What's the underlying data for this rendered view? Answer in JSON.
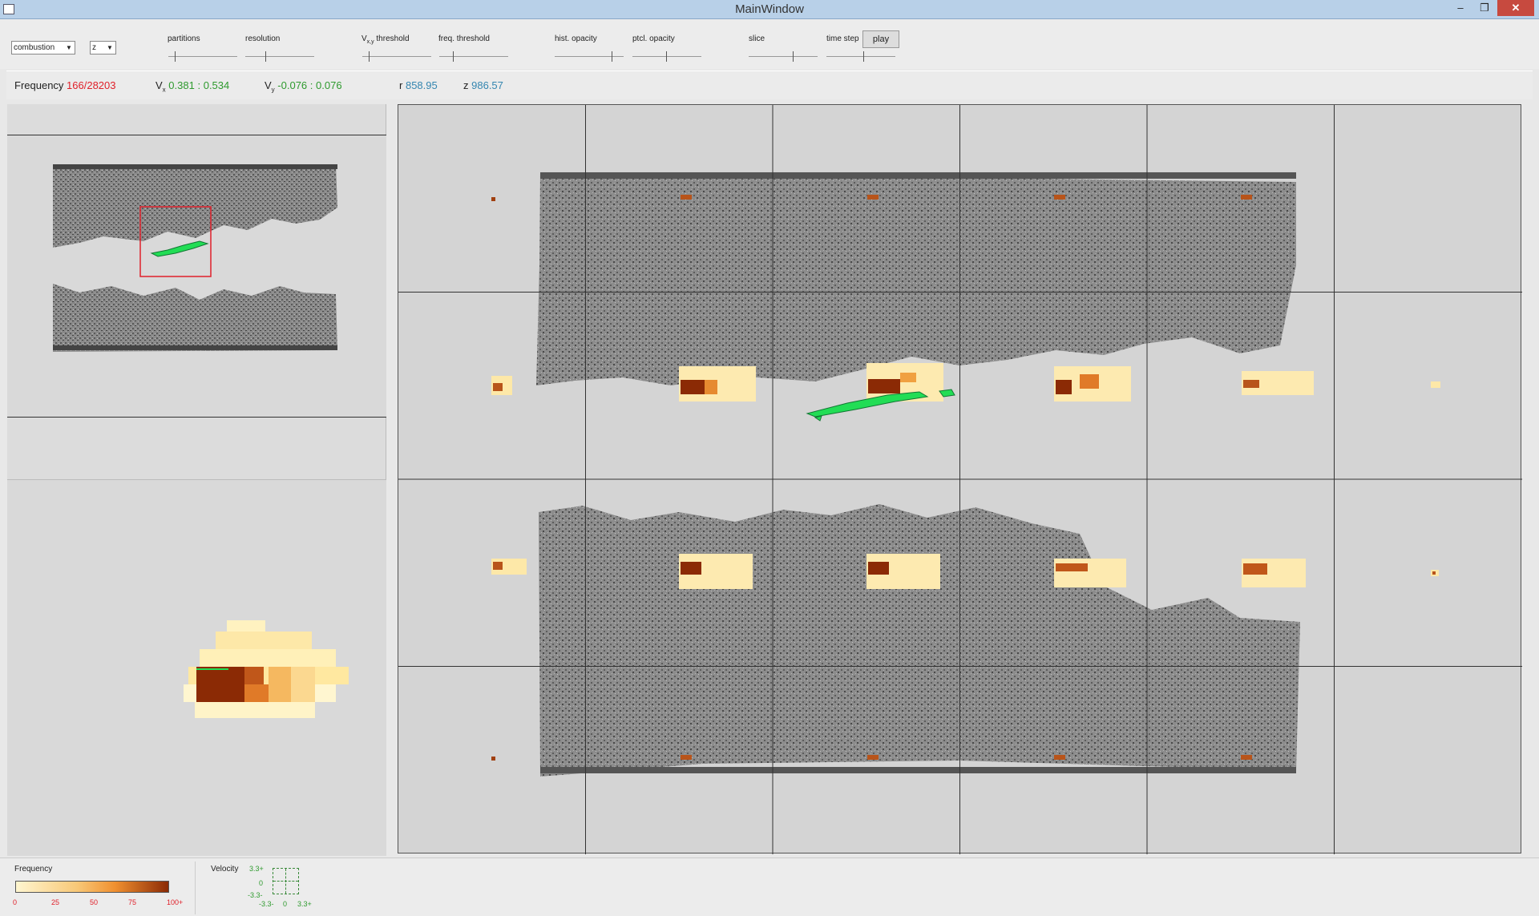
{
  "window": {
    "title": "MainWindow",
    "minimize": "–",
    "maximize": "❐",
    "close": "✕"
  },
  "toolbar": {
    "dataset_select": "combustion",
    "axis_select": "z",
    "labels": {
      "partitions": "partitions",
      "resolution": "resolution",
      "vxy_threshold_prefix": "V",
      "vxy_threshold_sub": "x,y",
      "vxy_threshold_suffix": " threshold",
      "freq_threshold": "freq. threshold",
      "hist_opacity": "hist. opacity",
      "ptcl_opacity": "ptcl. opacity",
      "slice": "slice",
      "time_step": "time step"
    },
    "play_label": "play",
    "slider_levels": {
      "partitions": 0.1,
      "resolution": 0.3,
      "vxy_threshold": 0.1,
      "freq_threshold": 0.2,
      "hist_opacity": 0.85,
      "ptcl_opacity": 0.5,
      "slice": 0.65,
      "time_step": 0.55
    }
  },
  "info": {
    "frequency_label": "Frequency",
    "frequency_value": "166/28203",
    "vx_label": "V",
    "vx_sub": "x",
    "vx_min": "0.381",
    "vx_sep": ":",
    "vx_max": "0.534",
    "vy_label": "V",
    "vy_sub": "y",
    "vy_min": "-0.076",
    "vy_sep": ":",
    "vy_max": "0.076",
    "r_label": "r",
    "r_value": "858.95",
    "z_label": "z",
    "z_value": "986.57"
  },
  "legend": {
    "frequency_title": "Frequency",
    "frequency_ticks": [
      "0",
      "25",
      "50",
      "75",
      "100+"
    ],
    "velocity_title": "Velocity",
    "velocity_y_ticks": [
      "3.3+",
      "0",
      "-3.3-"
    ],
    "velocity_x_ticks": [
      "-3.3-",
      "0",
      "3.3+"
    ]
  },
  "colors": {
    "freq_low": "#fff6d0",
    "freq_mid": "#f5a040",
    "freq_high": "#8b2a05",
    "selection": "#e0202a",
    "highlight_particles": "#22dd55",
    "green_text": "#2e9a2e",
    "blue_text": "#3486b0"
  }
}
